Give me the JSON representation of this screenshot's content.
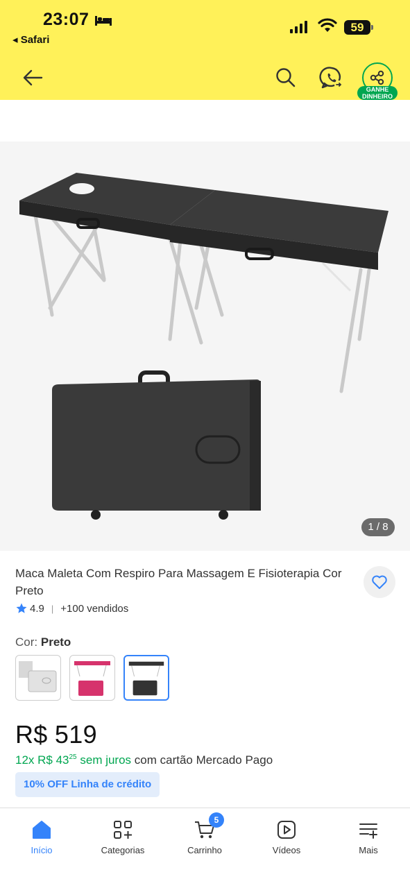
{
  "status_bar": {
    "time": "23:07",
    "back_app": "◂ Safari",
    "battery": "59"
  },
  "header": {
    "icons": [
      "arrow-left-icon",
      "search-icon",
      "whatsapp-icon",
      "share-icon"
    ],
    "share_badge_line1": "GANHE",
    "share_badge_line2": "DINHEIRO",
    "brand_color": "#fff159"
  },
  "gallery": {
    "counter": "1 / 8"
  },
  "product": {
    "title": "Maca Maleta Com Respiro Para Massagem E Fisioterapia Cor Preto",
    "rating": "4.9",
    "sold": "+100 vendidos",
    "variant_label": "Cor:",
    "variant_value": "Preto",
    "variants": [
      "Branco",
      "Rosa",
      "Preto"
    ],
    "selected_variant": 2,
    "price": "R$ 519",
    "installments_count": "12x R$ 43",
    "installments_cents": "25",
    "installments_no_interest": "sem juros",
    "installments_rest": "com cartão Mercado Pago",
    "credit_chip": "10% OFF Linha de crédito"
  },
  "tabbar": {
    "items": [
      {
        "label": "Início",
        "icon": "home-icon",
        "active": true
      },
      {
        "label": "Categorias",
        "icon": "categories-icon"
      },
      {
        "label": "Carrinho",
        "icon": "cart-icon",
        "badge": "5"
      },
      {
        "label": "Vídeos",
        "icon": "video-icon"
      },
      {
        "label": "Mais",
        "icon": "menu-plus-icon"
      }
    ]
  },
  "colors": {
    "accent_blue": "#3483fa",
    "green": "#00a650"
  }
}
